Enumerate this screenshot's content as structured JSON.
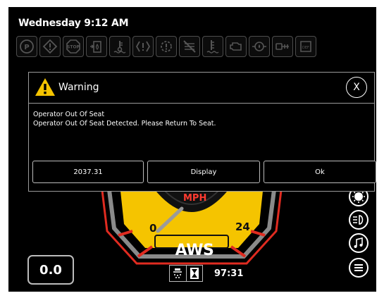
{
  "status": {
    "datetime": "Wednesday 9:12 AM"
  },
  "telltales": [
    "parking-brake-icon",
    "warning-triangle-icon",
    "stop-icon",
    "fuel-filter-icon",
    "coolant-temp-icon",
    "hydraulic-warning-icon",
    "transmission-warning-icon",
    "regen-inhibit-icon",
    "fluid-level-icon",
    "engine-icon",
    "oil-pressure-icon",
    "sprayer-boom-icon",
    "def-icon"
  ],
  "dialog": {
    "title": "Warning",
    "close_label": "X",
    "message_title": "Operator Out Of Seat",
    "message_body": "Operator Out Of Seat Detected. Please Return To Seat.",
    "buttons": [
      "2037.31",
      "Display",
      "Ok"
    ]
  },
  "dashboard": {
    "speed_value": "0.0",
    "gauge_unit": "MPH",
    "gauge_min": "0",
    "gauge_max": "24",
    "steer_mode": "AWS",
    "timer": "97:31",
    "accent_yellow": "#f5c400",
    "accent_red": "#e02b20"
  },
  "side_buttons": [
    "brightness-icon",
    "headlights-icon",
    "music-icon",
    "menu-icon"
  ]
}
